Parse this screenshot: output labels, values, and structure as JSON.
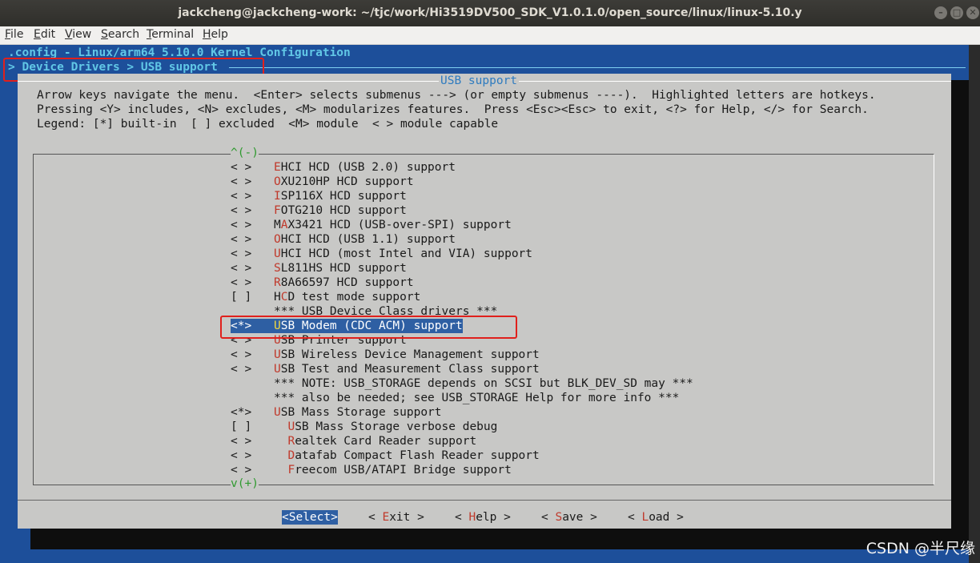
{
  "window": {
    "title": "jackcheng@jackcheng-work: ~/tjc/work/Hi3519DV500_SDK_V1.0.1.0/open_source/linux/linux-5.10.y",
    "minimize_glyph": "–",
    "maximize_glyph": "□",
    "close_glyph": "✕"
  },
  "menubar": [
    {
      "key": "F",
      "rest": "ile"
    },
    {
      "key": "E",
      "rest": "dit"
    },
    {
      "key": "V",
      "rest": "iew"
    },
    {
      "key": "S",
      "rest": "earch"
    },
    {
      "key": "T",
      "rest": "erminal"
    },
    {
      "key": "H",
      "rest": "elp"
    }
  ],
  "terminal": {
    "config_title": ".config - Linux/arm64 5.10.0 Kernel Configuration",
    "breadcrumb": "> Device Drivers > USB support"
  },
  "dialog": {
    "title": "USB support",
    "help_lines": [
      "Arrow keys navigate the menu.  <Enter> selects submenus ---> (or empty submenus ----).  Highlighted letters are hotkeys.",
      "Pressing <Y> includes, <N> excludes, <M> modularizes features.  Press <Esc><Esc> to exit, <?> for Help, </> for Search.",
      "Legend: [*] built-in  [ ] excluded  <M> module  < > module capable"
    ],
    "scroll_up": "^(-)",
    "scroll_down": "v(+)",
    "items": [
      {
        "state": "< >",
        "indent": "",
        "hotkey": "E",
        "rest": "HCI HCD (USB 2.0) support"
      },
      {
        "state": "< >",
        "indent": "",
        "hotkey": "O",
        "rest": "XU210HP HCD support"
      },
      {
        "state": "< >",
        "indent": "",
        "hotkey": "I",
        "rest": "SP116X HCD support"
      },
      {
        "state": "< >",
        "indent": "",
        "hotkey": "F",
        "rest": "OTG210 HCD support"
      },
      {
        "state": "< >",
        "indent": "",
        "pre": "M",
        "hotkey": "A",
        "rest": "X3421 HCD (USB-over-SPI) support"
      },
      {
        "state": "< >",
        "indent": "",
        "hotkey": "O",
        "rest": "HCI HCD (USB 1.1) support"
      },
      {
        "state": "< >",
        "indent": "",
        "hotkey": "U",
        "rest": "HCI HCD (most Intel and VIA) support"
      },
      {
        "state": "< >",
        "indent": "",
        "hotkey": "S",
        "rest": "L811HS HCD support"
      },
      {
        "state": "< >",
        "indent": "",
        "hotkey": "R",
        "rest": "8A66597 HCD support"
      },
      {
        "state": "[ ]",
        "indent": "",
        "pre": "H",
        "hotkey": "C",
        "rest": "D test mode support"
      },
      {
        "state": "",
        "indent": "",
        "hotkey": "",
        "rest": "*** USB Device Class drivers ***"
      },
      {
        "state": "<*>",
        "indent": "",
        "hotkey": "U",
        "rest": "SB Modem (CDC ACM) support",
        "selected": true
      },
      {
        "state": "< >",
        "indent": "",
        "hotkey": "U",
        "rest": "SB Printer support"
      },
      {
        "state": "< >",
        "indent": "",
        "hotkey": "U",
        "rest": "SB Wireless Device Management support"
      },
      {
        "state": "< >",
        "indent": "",
        "hotkey": "U",
        "rest": "SB Test and Measurement Class support"
      },
      {
        "state": "",
        "indent": "",
        "hotkey": "",
        "rest": "*** NOTE: USB_STORAGE depends on SCSI but BLK_DEV_SD may ***"
      },
      {
        "state": "",
        "indent": "",
        "hotkey": "",
        "rest": "*** also be needed; see USB_STORAGE Help for more info ***"
      },
      {
        "state": "<*>",
        "indent": "",
        "hotkey": "U",
        "rest": "SB Mass Storage support"
      },
      {
        "state": "[ ]",
        "indent": "  ",
        "hotkey": "U",
        "rest": "SB Mass Storage verbose debug"
      },
      {
        "state": "< >",
        "indent": "  ",
        "hotkey": "R",
        "rest": "ealtek Card Reader support"
      },
      {
        "state": "< >",
        "indent": "  ",
        "hotkey": "D",
        "rest": "atafab Compact Flash Reader support"
      },
      {
        "state": "< >",
        "indent": "  ",
        "hotkey": "F",
        "rest": "reecom USB/ATAPI Bridge support"
      }
    ],
    "buttons": [
      {
        "open": "<",
        "hotkey": "S",
        "rest": "elect",
        "close": ">",
        "selected": true
      },
      {
        "open": "< ",
        "hotkey": "E",
        "rest": "xit",
        "close": " >"
      },
      {
        "open": "< ",
        "hotkey": "H",
        "rest": "elp",
        "close": " >"
      },
      {
        "open": "< ",
        "hotkey": "S",
        "rest": "ave",
        "close": " >"
      },
      {
        "open": "< ",
        "hotkey": "L",
        "rest": "oad",
        "close": " >"
      }
    ]
  },
  "watermark": "CSDN @半尺缘",
  "colors": {
    "terminal_bg": "#1d4f9a",
    "dialog_bg": "#c8c8c6",
    "selection_bg": "#2e5fa3",
    "hotkey": "#c0392b",
    "annotation_box": "#e0201c"
  }
}
